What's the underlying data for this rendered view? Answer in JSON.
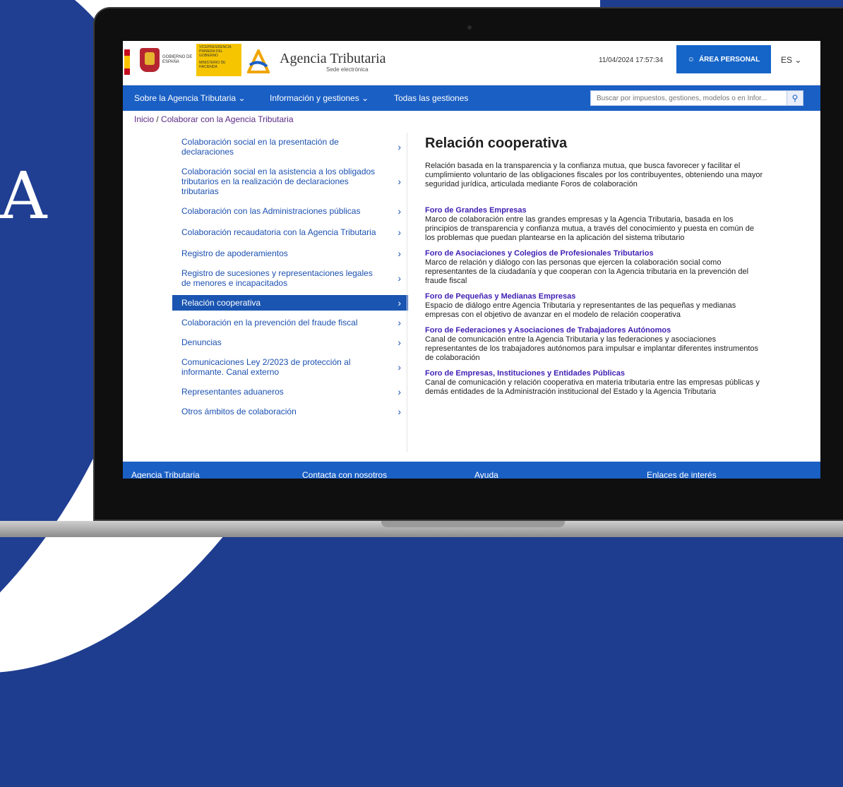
{
  "background_letter": "A",
  "header": {
    "gov_label": "GOBIERNO DE ESPAÑA",
    "vice_label": "VICEPRESIDENCIA PRIMERA DEL GOBIERNO",
    "ministry_label": "MINISTERIO DE HACIENDA",
    "site_name": "Agencia Tributaria",
    "site_sub": "Sede electrónica",
    "datetime": "11/04/2024 17:57:34",
    "area_button": "ÁREA PERSONAL",
    "lang": "ES"
  },
  "nav": {
    "items": [
      "Sobre la Agencia Tributaria",
      "Información y gestiones",
      "Todas las gestiones"
    ],
    "search_placeholder": "Buscar por impuestos, gestiones, modelos o en Infor..."
  },
  "breadcrumb": {
    "home": "Inicio",
    "sep": "/",
    "current": "Colaborar con la Agencia Tributaria"
  },
  "sidebar": {
    "items": [
      {
        "label": "Colaboración social en la presentación de declaraciones",
        "active": false
      },
      {
        "label": "Colaboración social en la asistencia a los obligados tributarios en la realización de declaraciones tributarias",
        "active": false
      },
      {
        "label": "Colaboración con las Administraciones públicas",
        "active": false
      },
      {
        "label": "Colaboración recaudatoria con la Agencia Tributaria",
        "active": false
      },
      {
        "label": "Registro de apoderamientos",
        "active": false
      },
      {
        "label": "Registro de sucesiones y representaciones legales de menores e incapacitados",
        "active": false
      },
      {
        "label": "Relación cooperativa",
        "active": true
      },
      {
        "label": "Colaboración en la prevención del fraude fiscal",
        "active": false
      },
      {
        "label": "Denuncias",
        "active": false
      },
      {
        "label": "Comunicaciones Ley 2/2023 de protección al informante. Canal externo",
        "active": false
      },
      {
        "label": "Representantes aduaneros",
        "active": false
      },
      {
        "label": "Otros ámbitos de colaboración",
        "active": false
      }
    ]
  },
  "content": {
    "title": "Relación cooperativa",
    "intro": "Relación basada en la transparencia y la confianza mutua, que busca favorecer y facilitar el cumplimiento voluntario de las obligaciones fiscales por los contribuyentes, obteniendo una mayor seguridad jurídica, articulada mediante Foros de colaboración",
    "forums": [
      {
        "title": "Foro de Grandes Empresas",
        "desc": "Marco de colaboración entre las grandes empresas y la Agencia Tributaria, basada en los principios de transparencia y confianza mutua, a través del conocimiento y puesta en común de los problemas que puedan plantearse en la aplicación del sistema tributario"
      },
      {
        "title": "Foro de Asociaciones y Colegios de Profesionales Tributarios",
        "desc": "Marco de relación y diálogo con las personas que ejercen la colaboración social como representantes de la ciudadanía y que cooperan con la Agencia tributaria en la prevención del fraude fiscal"
      },
      {
        "title": "Foro de Pequeñas y Medianas Empresas",
        "desc": "Espacio de diálogo entre Agencia Tributaria y representantes de las pequeñas y medianas empresas con el objetivo de avanzar en el modelo de relación cooperativa"
      },
      {
        "title": "Foro de Federaciones y Asociaciones de Trabajadores Autónomos",
        "desc": "Canal de comunicación entre la Agencia Tributaria y las federaciones y asociaciones representantes de los trabajadores autónomos para impulsar e implantar diferentes instrumentos de colaboración"
      },
      {
        "title": "Foro de Empresas, Instituciones y Entidades Públicas",
        "desc": "Canal de comunicación y relación cooperativa en materia tributaria entre las empresas públicas y demás entidades de la Administración institucional del Estado y la Agencia Tributaria"
      }
    ]
  },
  "footer": {
    "items": [
      "Agencia Tributaria",
      "Contacta con nosotros",
      "Ayuda",
      "Enlaces de interés"
    ]
  },
  "colors": {
    "brand_blue": "#1a5fc4",
    "forum_title": "#3f1eb3",
    "breadcrumb_link": "#5b2a86"
  }
}
